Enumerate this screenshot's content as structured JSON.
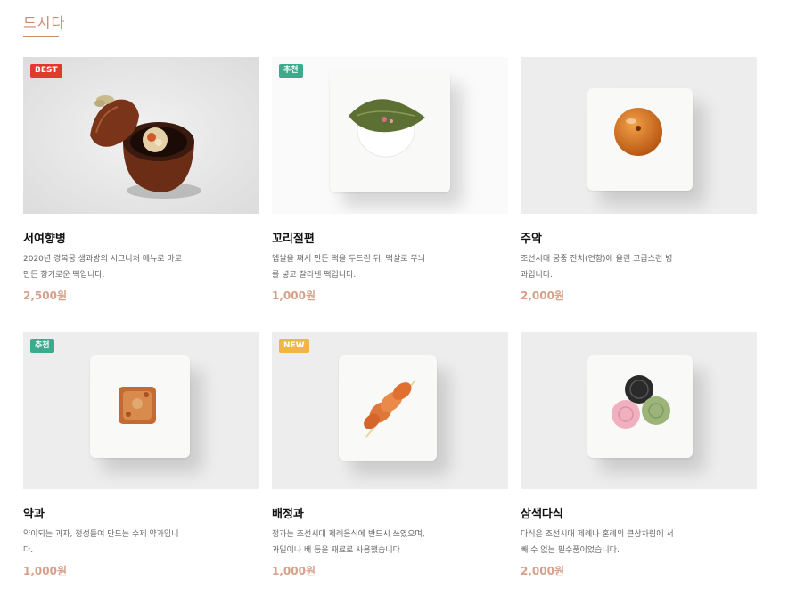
{
  "section": {
    "title": "드시다"
  },
  "products": [
    {
      "badge": "BEST",
      "name": "서여향병",
      "desc": "2020년 경복궁 생과방의 시그니처 메뉴로 마로 만든 향기로운 떡입니다.",
      "price": "2,500원"
    },
    {
      "badge": "추천",
      "name": "꼬리절편",
      "desc": "멥쌀을 쪄서 만든 떡을 두드린 뒤, 떡살로 무늬를 넣고 잘라낸 떡입니다.",
      "price": "1,000원"
    },
    {
      "badge": "",
      "name": "주악",
      "desc": "조선시대 궁중 잔치(연향)에 올린 고급스런 병과입니다.",
      "price": "2,000원"
    },
    {
      "badge": "추천",
      "name": "약과",
      "desc": "약이되는 과자, 정성들여 만드는 수제 약과입니다.",
      "price": "1,000원"
    },
    {
      "badge": "NEW",
      "name": "배정과",
      "desc": "정과는 조선시대 제례음식에 반드시 쓰였으며, 과일이나 배 등을 재료로 사용했습니다",
      "price": "1,000원"
    },
    {
      "badge": "",
      "name": "삼색다식",
      "desc": "다식은 조선시대 제례나 혼례의 큰상차림에 서 빼 수 없는 필수품이었습니다.",
      "price": "2,000원"
    }
  ],
  "colors": {
    "accent": "#d08a6e",
    "price": "#d6a08a",
    "best": "#e03a2f",
    "recommend": "#3bab8e",
    "new": "#f0b544"
  }
}
